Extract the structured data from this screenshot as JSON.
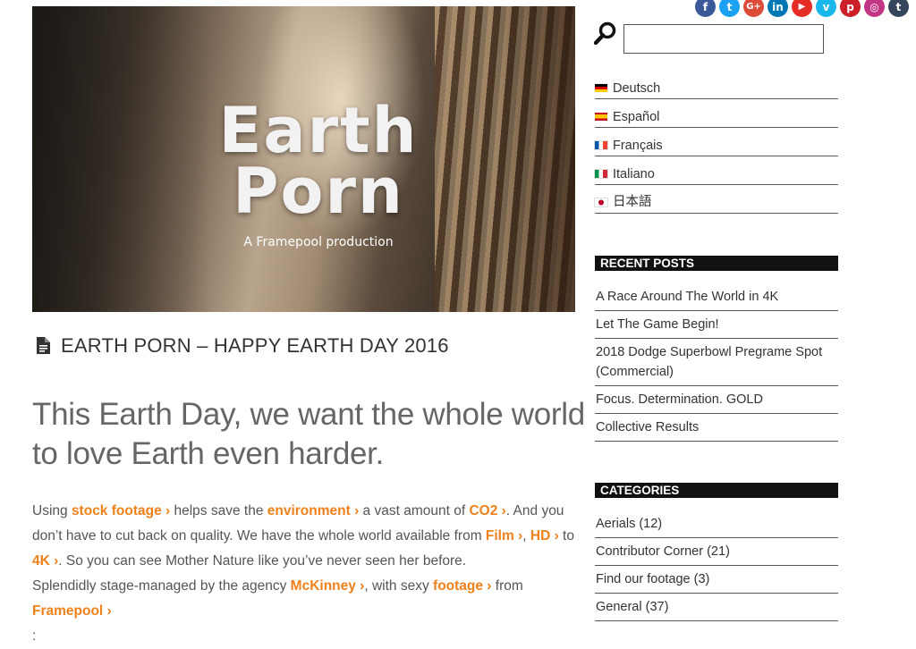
{
  "hero": {
    "logo_line1": "Earth",
    "logo_line2": "Porn",
    "tagline": "A Framepool production"
  },
  "post": {
    "title": "EARTH PORN – HAPPY EARTH DAY 2016",
    "headline": "This Earth Day, we want the whole world to love Earth even harder.",
    "body": {
      "t1": "Using ",
      "l1": "stock footage ›",
      "t2": " helps save the ",
      "l2": "environment ›",
      "t3": " a vast amount of ",
      "l3": "CO2 ›",
      "t4": ". And you don’t have to cut back on quality. We have the whole world available from ",
      "l4": "Film ›",
      "t5": ", ",
      "l5": "HD ›",
      "t6": " to ",
      "l6": "4K ›",
      "t7": ". So you can see Mother Nature like you’ve never seen her before.",
      "t8": "Splendidly stage-managed by the agency ",
      "l7": "McKinney ›",
      "t9": ", with sexy ",
      "l8": "footage ›",
      "t10": " from ",
      "l9": "Framepool ›",
      "t11": ":"
    }
  },
  "social": [
    {
      "icon": "facebook-icon",
      "glyph": "f",
      "color": "#3b5998"
    },
    {
      "icon": "twitter-icon",
      "glyph": "t",
      "color": "#1da1f2"
    },
    {
      "icon": "google-plus-icon",
      "glyph": "G+",
      "color": "#dd4b39"
    },
    {
      "icon": "linkedin-icon",
      "glyph": "in",
      "color": "#0077b5"
    },
    {
      "icon": "youtube-icon",
      "glyph": "▶",
      "color": "#e52d27"
    },
    {
      "icon": "vimeo-icon",
      "glyph": "v",
      "color": "#1ab7ea"
    },
    {
      "icon": "pinterest-icon",
      "glyph": "p",
      "color": "#cb2027"
    },
    {
      "icon": "instagram-icon",
      "glyph": "◎",
      "color": "#c13584"
    },
    {
      "icon": "tumblr-icon",
      "glyph": "t",
      "color": "#35465c"
    }
  ],
  "search": {
    "placeholder": ""
  },
  "languages": [
    {
      "label": "Deutsch",
      "flag": "de"
    },
    {
      "label": "Español",
      "flag": "es"
    },
    {
      "label": "Français",
      "flag": "fr"
    },
    {
      "label": "Italiano",
      "flag": "it"
    },
    {
      "label": "日本語",
      "flag": "jp"
    }
  ],
  "recent_posts": {
    "title": "RECENT POSTS",
    "items": [
      "A Race Around The World in 4K",
      "Let The Game Begin!",
      "2018 Dodge Superbowl Pregrame Spot (Commercial)",
      "Focus. Determination. GOLD",
      "Collective Results"
    ]
  },
  "categories": {
    "title": "CATEGORIES",
    "items": [
      "Aerials (12)",
      "Contributor Corner (21)",
      "Find our footage (3)",
      "General (37)"
    ]
  },
  "colors": {
    "link": "#f0801a",
    "widget_bg": "#111111"
  }
}
